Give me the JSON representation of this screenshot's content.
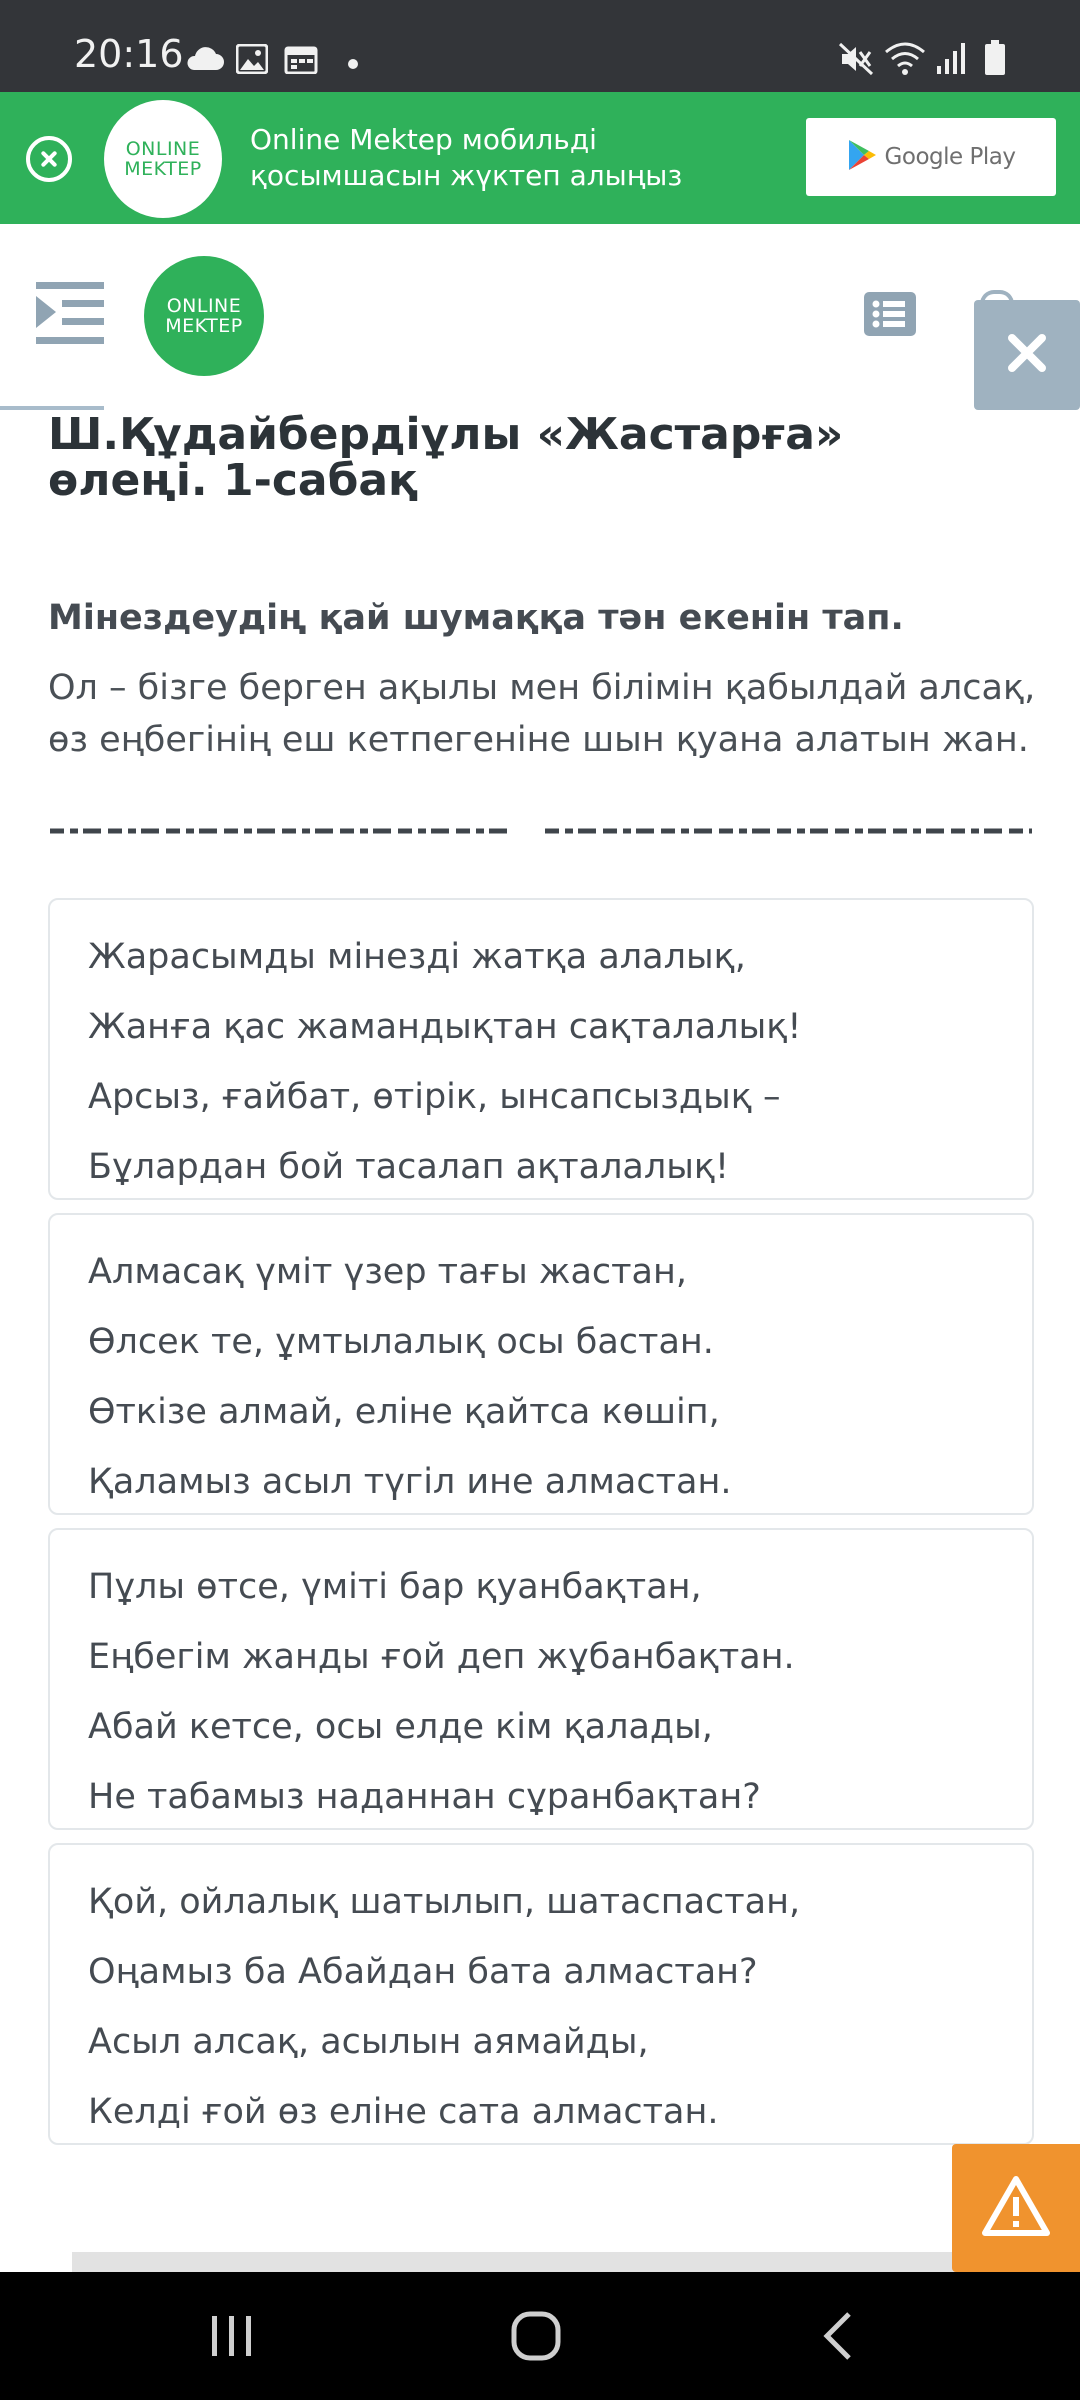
{
  "status_bar": {
    "time": "20:16",
    "left_icons": [
      "cloud-icon",
      "image-icon",
      "calendar-icon",
      "dot-icon"
    ],
    "right_icons": [
      "mute-icon",
      "wifi-icon",
      "signal-icon",
      "battery-icon"
    ]
  },
  "banner": {
    "logo_line1": "ONLINE",
    "logo_line2": "MEKTEP",
    "text": "Online Mektep мобильді қосымшасын жүктеп алыңыз",
    "store_button": "Google Play"
  },
  "header": {
    "logo_line1": "ONLINE",
    "logo_line2": "MEKTEP"
  },
  "page": {
    "title": "Ш.Құдайбердіұлы «Жастарға» өлеңі. 1-сабақ",
    "question": "Мінездеудің қай шумаққа тән екенін тап.",
    "prompt": "Ол – бізге берген ақылы мен білімін қабылдай алсақ, өз еңбегінің еш кетпегеніне шын қуана алатын жан."
  },
  "options": [
    {
      "lines": [
        "Жарасымды мінезді жатқа алалық,",
        "Жанға қас жамандықтан сақталалық!",
        "Арсыз, ғайбат, өтірік, ынсапсыздық –",
        "Бұлардан бой тасалап ақталалық!"
      ]
    },
    {
      "lines": [
        "Алмасақ үміт үзер тағы жастан,",
        "Өлсек те, ұмтылалық осы бастан.",
        "Өткізе алмай, еліне қайтса көшіп,",
        "Қаламыз асыл түгіл ине алмастан."
      ]
    },
    {
      "lines": [
        "Пұлы өтсе, үміті бар қуанбақтан,",
        "Еңбегім жанды ғой деп жұбанбақтан.",
        "Абай кетсе, осы елде кім қалады,",
        "Не табамыз наданнан сұранбақтан?"
      ]
    },
    {
      "lines": [
        "Қой, ойлалық шатылып, шатаспастан,",
        "Оңамыз ба Абайдан бата алмастан?",
        "Асыл алсақ, асылын аямайды,",
        "Келді ғой өз еліне сата алмастан."
      ]
    }
  ],
  "colors": {
    "brand_green": "#2fb15a",
    "alert_orange": "#f0932e",
    "header_icon_gray": "#90a4b3"
  }
}
